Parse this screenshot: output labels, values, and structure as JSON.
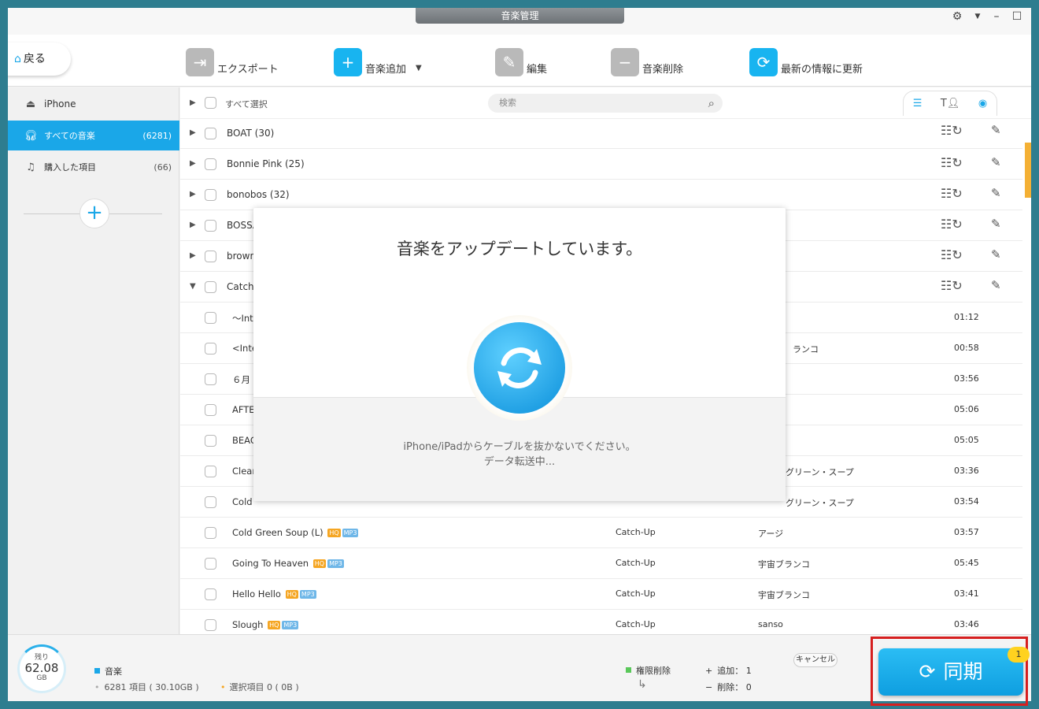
{
  "window": {
    "title": "音楽管理"
  },
  "toolbar": {
    "back_label": "戻る",
    "export_label": "エクスポート",
    "add_music_label": "音楽追加",
    "edit_label": "編集",
    "delete_music_label": "音楽削除",
    "refresh_label": "最新の情報に更新"
  },
  "sidebar": {
    "device": "iPhone",
    "items": [
      {
        "label": "すべての音楽",
        "count": "(6281)",
        "icon": "headphones-icon",
        "active": true
      },
      {
        "label": "購入した項目",
        "count": "(66)",
        "icon": "music-list-icon",
        "active": false
      }
    ]
  },
  "list": {
    "select_all_label": "すべて選択",
    "search_placeholder": "検索",
    "groups": [
      {
        "title": "BOAT (30)"
      },
      {
        "title": "Bonnie Pink (25)"
      },
      {
        "title": "bonobos (32)"
      },
      {
        "title": "BOSSA"
      },
      {
        "title": "brown"
      },
      {
        "title": "Catch"
      }
    ],
    "songs": [
      {
        "title": "～Int",
        "album": "",
        "artist": "",
        "time": "01:12"
      },
      {
        "title": "<Inte",
        "album": "",
        "artist": "ランコ",
        "time": "00:58"
      },
      {
        "title": "６月",
        "album": "",
        "artist": "",
        "time": "03:56"
      },
      {
        "title": "AFTE",
        "album": "",
        "artist": "",
        "time": "05:06"
      },
      {
        "title": "BEAC",
        "album": "",
        "artist": "",
        "time": "05:05"
      },
      {
        "title": "Clear",
        "album": "",
        "artist": "グリーン・スープ",
        "time": "03:36"
      },
      {
        "title": "Cold",
        "album": "",
        "artist": "グリーン・スープ",
        "time": "03:54"
      },
      {
        "title": "Cold Green Soup (L)",
        "album": "Catch-Up",
        "artist": "アージ",
        "time": "03:57"
      },
      {
        "title": "Going To Heaven",
        "album": "Catch-Up",
        "artist": "宇宙ブランコ",
        "time": "05:45"
      },
      {
        "title": "Hello Hello",
        "album": "Catch-Up",
        "artist": "宇宙ブランコ",
        "time": "03:41"
      },
      {
        "title": "Slough",
        "album": "Catch-Up",
        "artist": "sanso",
        "time": "03:46"
      }
    ],
    "badge_hq": "HQ",
    "badge_mp3": "MP3"
  },
  "modal": {
    "title": "音楽をアップデートしています。",
    "line1": "iPhone/iPadからケーブルを抜かないでください。",
    "line2": "データ転送中..."
  },
  "footer": {
    "remaining_label": "残り",
    "remaining_value": "62.08",
    "remaining_unit": "GB",
    "music_label": "音楽",
    "items_text": "6281 項目 ( 30.10GB )",
    "selected_text": "選択項目 0 ( 0B )",
    "permission_delete_label": "権限削除",
    "add_text": "追加： 1",
    "delete_text": "削除： 0",
    "cancel_label": "キャンセル",
    "sync_label": "同期",
    "sync_badge": "1"
  },
  "colors": {
    "accent": "#1aa7e8",
    "highlight": "#d61f1f",
    "badge": "#ffd21f"
  }
}
